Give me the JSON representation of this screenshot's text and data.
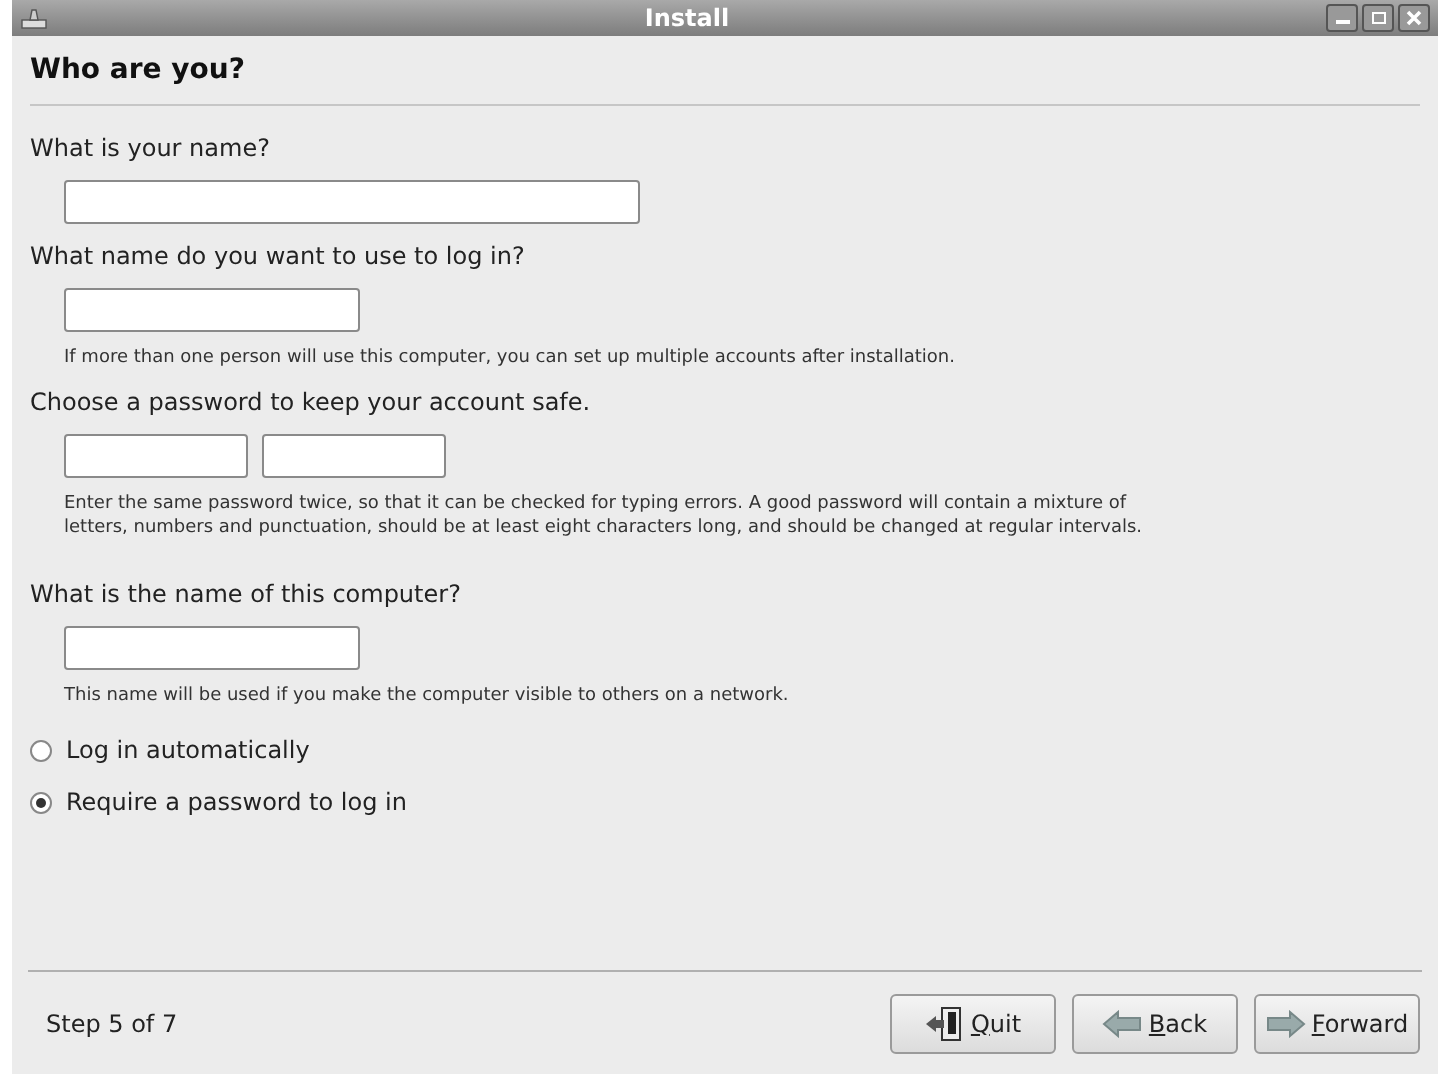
{
  "window": {
    "title": "Install"
  },
  "heading": "Who are you?",
  "sections": [
    {
      "question": "What is your name?",
      "fields": [
        {
          "kind": "wide"
        }
      ]
    },
    {
      "question": "What name do you want to use to log in?",
      "fields": [
        {
          "kind": "medium"
        }
      ],
      "hint": "If more than one person will use this computer, you can set up multiple accounts after installation."
    },
    {
      "question": "Choose a password to keep your account safe.",
      "fields": [
        {
          "kind": "small"
        },
        {
          "kind": "small"
        }
      ],
      "hint": "Enter the same password twice, so that it can be checked for typing errors. A good password will contain a mixture of letters, numbers and punctuation, should be at least eight characters long, and should be changed at regular intervals."
    },
    {
      "question": "What is the name of this computer?",
      "fields": [
        {
          "kind": "medium"
        }
      ],
      "hint": "This name will be used if you make the computer visible to others on a network."
    }
  ],
  "login_options": [
    {
      "label": "Log in automatically",
      "selected": false
    },
    {
      "label": "Require a password to log in",
      "selected": true
    }
  ],
  "status_bar": {
    "step": "Step 5 of 7"
  },
  "buttons": [
    {
      "kind": "quit",
      "label": "Quit"
    },
    {
      "kind": "back",
      "label": "Back"
    },
    {
      "kind": "forward",
      "label": "Forward"
    }
  ]
}
